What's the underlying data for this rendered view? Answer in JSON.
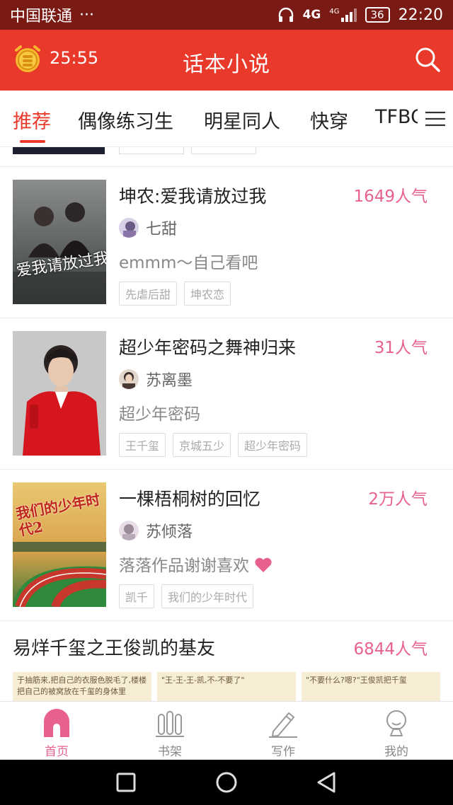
{
  "status_bar": {
    "carrier": "中国联通",
    "dots": "···",
    "network": "4G",
    "network2": "4G",
    "battery": "36",
    "time": "22:20"
  },
  "app_bar": {
    "timer": "25:55",
    "title": "话本小说"
  },
  "tabs": [
    {
      "label": "推荐",
      "active": true
    },
    {
      "label": "偶像练习生"
    },
    {
      "label": "明星同人"
    },
    {
      "label": "快穿"
    },
    {
      "label": "TFBOYS"
    }
  ],
  "books": [
    {
      "title": "坤农:爱我请放过我",
      "popularity": "1649人气",
      "author": "七甜",
      "description": "emmm～自己看吧",
      "tags": [
        "先虐后甜",
        "坤农恋"
      ],
      "cover_text": "爱我请放过我"
    },
    {
      "title": "超少年密码之舞神归来",
      "popularity": "31人气",
      "author": "苏离墨",
      "description": "超少年密码",
      "tags": [
        "王千玺",
        "京城五少",
        "超少年密码"
      ]
    },
    {
      "title": "一棵梧桐树的回忆",
      "popularity": "2万人气",
      "author": "苏倾落",
      "description": "落落作品谢谢喜欢",
      "tags": [
        "凯千",
        "我们的少年时代"
      ],
      "cover_text": "我们的少年时代2"
    }
  ],
  "section": {
    "title": "易烊千玺之王俊凯的基友",
    "popularity": "6844人气",
    "previews": [
      "于抽筋来,把自己的衣服色脱毛了,楼楼把自己的被窝放在千玺的身体里",
      "\"王-王-王-凯,不-不要了\"",
      "\"不要什么?嗯?\"王俊凯把千玺"
    ]
  },
  "bottom_nav": [
    {
      "label": "首页",
      "icon": "home-icon",
      "active": true
    },
    {
      "label": "书架",
      "icon": "bookshelf-icon"
    },
    {
      "label": "写作",
      "icon": "pen-icon"
    },
    {
      "label": "我的",
      "icon": "profile-icon"
    }
  ],
  "colors": {
    "primary": "#e8392a",
    "status_bar": "#7a1a14",
    "popularity": "#e8608f"
  }
}
